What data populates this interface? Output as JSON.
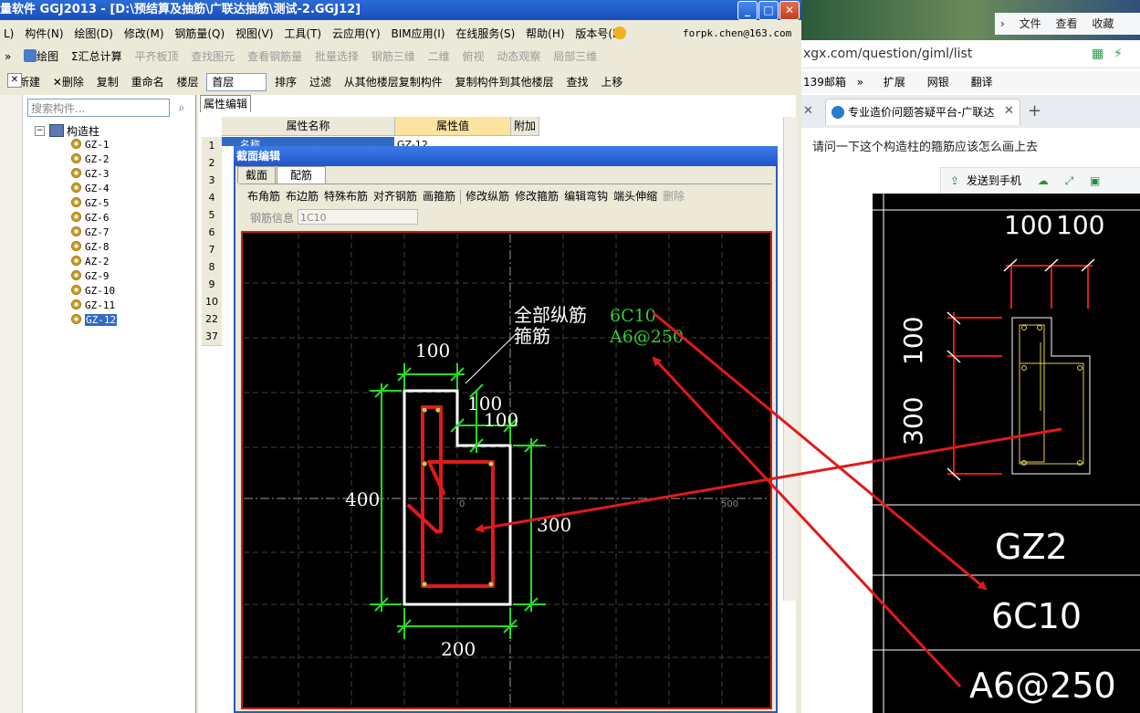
{
  "app": {
    "title": "量软件 GGJ2013 - [D:\\预结算及抽筋\\广联达抽筋\\测试-2.GGJ12]",
    "menu": [
      "L)",
      "构件(N)",
      "绘图(D)",
      "修改(M)",
      "钢筋量(Q)",
      "视图(V)",
      "工具(T)",
      "云应用(Y)",
      "BIM应用(I)",
      "在线服务(S)",
      "帮助(H)",
      "版本号(B)"
    ],
    "account": "forpk.chen@163.com",
    "toolbar1": [
      "绘图",
      "汇总计算",
      "平齐板顶",
      "查找图元",
      "查看钢筋量",
      "批量选择",
      "钢筋三维",
      "二维",
      "俯视",
      "动态观察",
      "局部三维"
    ],
    "toolbar2": [
      "新建",
      "删除",
      "复制",
      "重命名",
      "楼层",
      "首层",
      "排序",
      "过滤",
      "从其他楼层复制构件",
      "复制构件到其他楼层",
      "查找",
      "上移"
    ],
    "search_placeholder": "搜索构件...",
    "tree_root": "构造柱",
    "tree_items": [
      "GZ-1",
      "GZ-2",
      "GZ-3",
      "GZ-4",
      "GZ-5",
      "GZ-6",
      "GZ-7",
      "GZ-8",
      "AZ-2",
      "GZ-9",
      "GZ-10",
      "GZ-11",
      "GZ-12"
    ],
    "selected_item": "GZ-12",
    "prop_tab": "属性编辑",
    "prop_headers": [
      "属性名称",
      "属性值",
      "附加"
    ],
    "row_numbers": [
      "1",
      "2",
      "3",
      "4",
      "5",
      "6",
      "7",
      "8",
      "9",
      "10",
      "22",
      "37"
    ],
    "row1_name": "名称",
    "row1_value": "GZ-12"
  },
  "dialog": {
    "title": "截面编辑",
    "tabs": [
      "截面",
      "配筋"
    ],
    "tools": [
      "布角筋",
      "布边筋",
      "特殊布筋",
      "对齐钢筋",
      "画箍筋",
      "修改纵筋",
      "修改箍筋",
      "编辑弯钩",
      "端头伸缩",
      "删除"
    ],
    "rebar_info_label": "钢筋信息",
    "rebar_info_value": "1C10",
    "drawing": {
      "label_all": "全部纵筋",
      "label_stirrup": "箍筋",
      "value_all": "6C10",
      "value_stirrup": "A6@250",
      "dim_top": "100",
      "dim_notch_h": "100",
      "dim_notch_v": "100",
      "dim_left": "400",
      "dim_right": "300",
      "dim_bottom": "200",
      "origin": "0",
      "axis_500": "500"
    }
  },
  "browser": {
    "menu": [
      "文件",
      "查看",
      "收藏"
    ],
    "address": "xgx.com/question/giml/list",
    "favorites": [
      "139邮箱",
      "扩展",
      "网银",
      "翻译"
    ],
    "tab_title": "专业造价问题答疑平台-广联达",
    "question": "请问一下这个构造柱的箍筋应该怎么画上去",
    "actions": [
      "发送到手机"
    ],
    "cad": {
      "dim_top_a": "100",
      "dim_top_b": "100",
      "dim_side_a": "100",
      "dim_side_b": "300",
      "name": "GZ2",
      "long_bar": "6C10",
      "stirrup": "A6@250"
    }
  }
}
